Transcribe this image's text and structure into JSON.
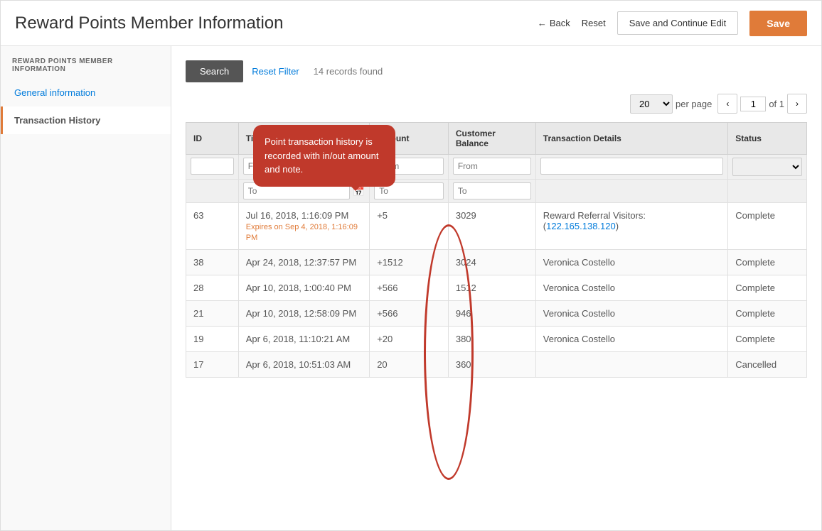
{
  "header": {
    "title": "Reward Points Member Information",
    "back_label": "Back",
    "reset_label": "Reset",
    "save_continue_label": "Save and Continue Edit",
    "save_label": "Save"
  },
  "sidebar": {
    "section_title": "REWARD POINTS MEMBER INFORMATION",
    "items": [
      {
        "id": "general-information",
        "label": "General information",
        "active": false
      },
      {
        "id": "transaction-history",
        "label": "Transaction History",
        "active": true
      }
    ]
  },
  "toolbar": {
    "search_label": "Search",
    "reset_filter_label": "Reset Filter",
    "records_found": "14 records found"
  },
  "pagination": {
    "per_page": "20",
    "per_page_label": "per page",
    "current_page": "1",
    "of_label": "of 1"
  },
  "table": {
    "columns": [
      {
        "id": "id",
        "label": "ID"
      },
      {
        "id": "time",
        "label": "Time"
      },
      {
        "id": "amount",
        "label": "Amount"
      },
      {
        "id": "customer_balance",
        "label": "Customer Balance"
      },
      {
        "id": "transaction_details",
        "label": "Transaction Details"
      },
      {
        "id": "status",
        "label": "Status"
      }
    ],
    "filters": {
      "amount_from": "From",
      "amount_to": "To",
      "balance_from": "From",
      "balance_to": "To"
    },
    "rows": [
      {
        "id": "63",
        "time": "Jul 16, 2018, 1:16:09 PM",
        "expires": "Expires on Sep 4, 2018, 1:16:09 PM",
        "amount": "+5",
        "balance": "3029",
        "details": "Reward Referral Visitors: (122.165.138.120)",
        "status": "Complete"
      },
      {
        "id": "38",
        "time": "Apr 24, 2018, 12:37:57 PM",
        "expires": "",
        "amount": "+1512",
        "balance": "3024",
        "details": "Veronica Costello",
        "status": "Complete"
      },
      {
        "id": "28",
        "time": "Apr 10, 2018, 1:00:40 PM",
        "expires": "",
        "amount": "+566",
        "balance": "1512",
        "details": "Veronica Costello",
        "status": "Complete"
      },
      {
        "id": "21",
        "time": "Apr 10, 2018, 12:58:09 PM",
        "expires": "",
        "amount": "+566",
        "balance": "946",
        "details": "Veronica Costello",
        "status": "Complete"
      },
      {
        "id": "19",
        "time": "Apr 6, 2018, 11:10:21 AM",
        "expires": "",
        "amount": "+20",
        "balance": "380",
        "details": "Veronica Costello",
        "status": "Complete"
      },
      {
        "id": "17",
        "time": "Apr 6, 2018, 10:51:03 AM",
        "expires": "",
        "amount": "20",
        "balance": "360",
        "details": "",
        "status": "Cancelled"
      }
    ]
  },
  "callout": {
    "text": "Point transaction history is recorded with in/out amount and note."
  },
  "icons": {
    "back_arrow": "←",
    "chevron_left": "‹",
    "chevron_right": "›",
    "calendar": "📅",
    "dropdown": "▼"
  }
}
